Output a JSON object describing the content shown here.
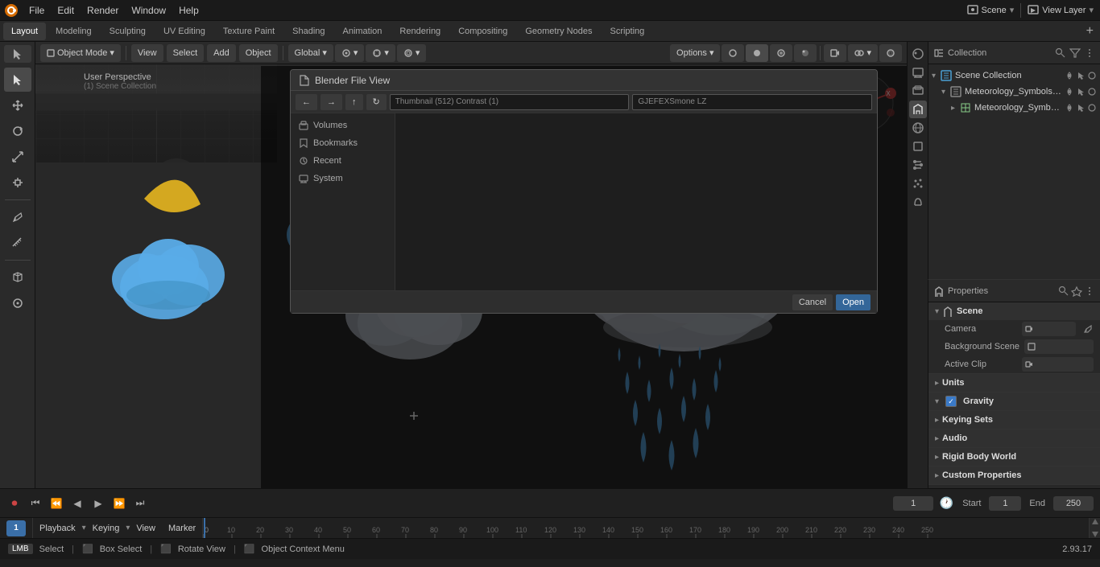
{
  "app": {
    "title": "Blender",
    "version": "2.93.17"
  },
  "menu": {
    "items": [
      "File",
      "Edit",
      "Render",
      "Window",
      "Help"
    ]
  },
  "workspace_tabs": {
    "tabs": [
      "Layout",
      "Modeling",
      "Sculpting",
      "UV Editing",
      "Texture Paint",
      "Shading",
      "Animation",
      "Rendering",
      "Compositing",
      "Geometry Nodes",
      "Scripting"
    ],
    "active": "Layout"
  },
  "viewport": {
    "mode": "Object Mode",
    "view_label": "User Perspective",
    "scene_collection": "(1) Scene Collection",
    "global_label": "Global",
    "header_buttons": [
      "Object Mode",
      "View",
      "Select",
      "Add",
      "Object"
    ]
  },
  "outliner": {
    "title": "Collection",
    "items": [
      {
        "label": "Meteorology_Symbols_with_M",
        "icon": "▷",
        "indent": 0
      },
      {
        "label": "Meteorology_Symbols_w",
        "icon": "▸",
        "indent": 1
      }
    ]
  },
  "properties": {
    "active_tab": "scene",
    "scene_name": "Scene",
    "camera_label": "Camera",
    "background_scene_label": "Background Scene",
    "active_clip_label": "Active Clip",
    "sections": [
      {
        "id": "scene",
        "label": "Scene",
        "expanded": true
      },
      {
        "id": "units",
        "label": "Units",
        "collapsed": true
      },
      {
        "id": "gravity",
        "label": "Gravity",
        "collapsed": false,
        "checkbox": true
      },
      {
        "id": "keying_sets",
        "label": "Keying Sets",
        "collapsed": true
      },
      {
        "id": "audio",
        "label": "Audio",
        "collapsed": true
      },
      {
        "id": "rigid_body_world",
        "label": "Rigid Body World",
        "collapsed": true
      },
      {
        "id": "custom_properties",
        "label": "Custom Properties",
        "collapsed": true
      }
    ]
  },
  "timeline": {
    "playback_label": "Playback",
    "keying_label": "Keying",
    "view_label": "View",
    "marker_label": "Marker",
    "frame_current": "1",
    "start_label": "Start",
    "start_value": "1",
    "end_label": "End",
    "end_value": "250",
    "ruler_marks": [
      "0",
      "10",
      "20",
      "30",
      "40",
      "50",
      "60",
      "70",
      "80",
      "90",
      "100",
      "110",
      "120",
      "130",
      "140",
      "150",
      "160",
      "170",
      "180",
      "190",
      "200",
      "210",
      "220",
      "230",
      "240",
      "250"
    ]
  },
  "status_bar": {
    "select_label": "Select",
    "box_select_label": "Box Select",
    "rotate_view_label": "Rotate View",
    "context_menu_label": "Object Context Menu",
    "version": "2.93.17"
  },
  "file_dialog": {
    "title": "Blender File View",
    "path_label": "Thumbnail (512) Contrast (1)",
    "toolbar": {
      "back": "←",
      "forward": "→",
      "up": "↑",
      "path1": "Thumbnail (512) Contrast (1)",
      "path2": "GJEFEXSmone LZ"
    },
    "sidebar_items": [
      "Volumes",
      "Bookmarks",
      "Recent",
      "System"
    ]
  },
  "icons": {
    "arrow_down": "▾",
    "arrow_right": "▸",
    "arrow_left": "◂",
    "camera": "📷",
    "scene": "🎬",
    "close": "✕",
    "check": "✓",
    "dot": "●",
    "triangle_right": "▶",
    "triangle_left": "◀",
    "skip_prev": "⏮",
    "skip_next": "⏭",
    "play": "▶",
    "record": "⏺",
    "jump_start": "⏮",
    "jump_end": "⏭",
    "step_back": "⏪",
    "step_fwd": "⏩"
  },
  "colors": {
    "accent_blue": "#4a90d9",
    "cloud_gray": "#b0b8c8",
    "cloud_blue": "#4a9fd4",
    "moon_yellow": "#d4a820",
    "rain_blue": "#4a9fd4",
    "grid_line": "#363636",
    "axis_red": "#cc3333",
    "axis_green": "#33cc33",
    "axis_blue": "#3366cc"
  }
}
